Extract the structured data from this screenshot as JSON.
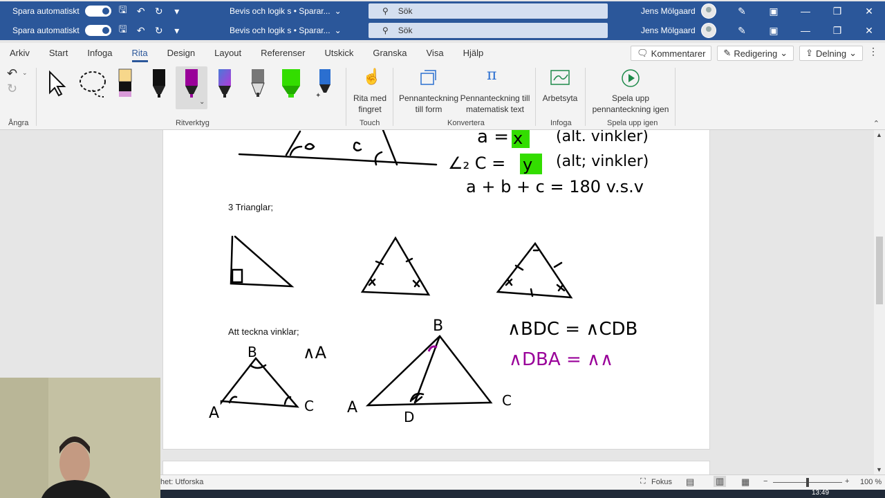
{
  "titlebar": {
    "autosave_label": "Spara automatiskt",
    "doc_title": "Bevis och logik s • Sparar...",
    "search_label": "Sök",
    "user_name": "Jens Mölgaard"
  },
  "menu": {
    "tabs": [
      "Arkiv",
      "Start",
      "Infoga",
      "Rita",
      "Design",
      "Layout",
      "Referenser",
      "Utskick",
      "Granska",
      "Visa",
      "Hjälp"
    ],
    "active_tab": "Rita",
    "comments": "Kommentarer",
    "editing": "Redigering",
    "share": "Delning"
  },
  "ribbon": {
    "undo_group": "Ångra",
    "tools_group": "Ritverktyg",
    "touch_btn_line1": "Rita med",
    "touch_btn_line2": "fingret",
    "touch_group": "Touch",
    "convert_shape_line1": "Pennanteckning",
    "convert_shape_line2": "till form",
    "convert_math_line1": "Pennanteckning till",
    "convert_math_line2": "matematisk text",
    "convert_group": "Konvertera",
    "canvas_btn": "Arbetsyta",
    "insert_group": "Infoga",
    "replay_line1": "Spela upp",
    "replay_line2": "pennanteckning igen",
    "replay_group": "Spela upp igen"
  },
  "document": {
    "text_triangles": "3 Trianglar;",
    "text_angles": "Att teckna vinklar;"
  },
  "status": {
    "left_text": "het: Utforska",
    "focus": "Fokus",
    "zoom": "100 %",
    "clock": "13:49"
  },
  "colors": {
    "accent": "#2b579a",
    "pen_magenta": "#990099",
    "highlight_green": "#33dd00"
  }
}
